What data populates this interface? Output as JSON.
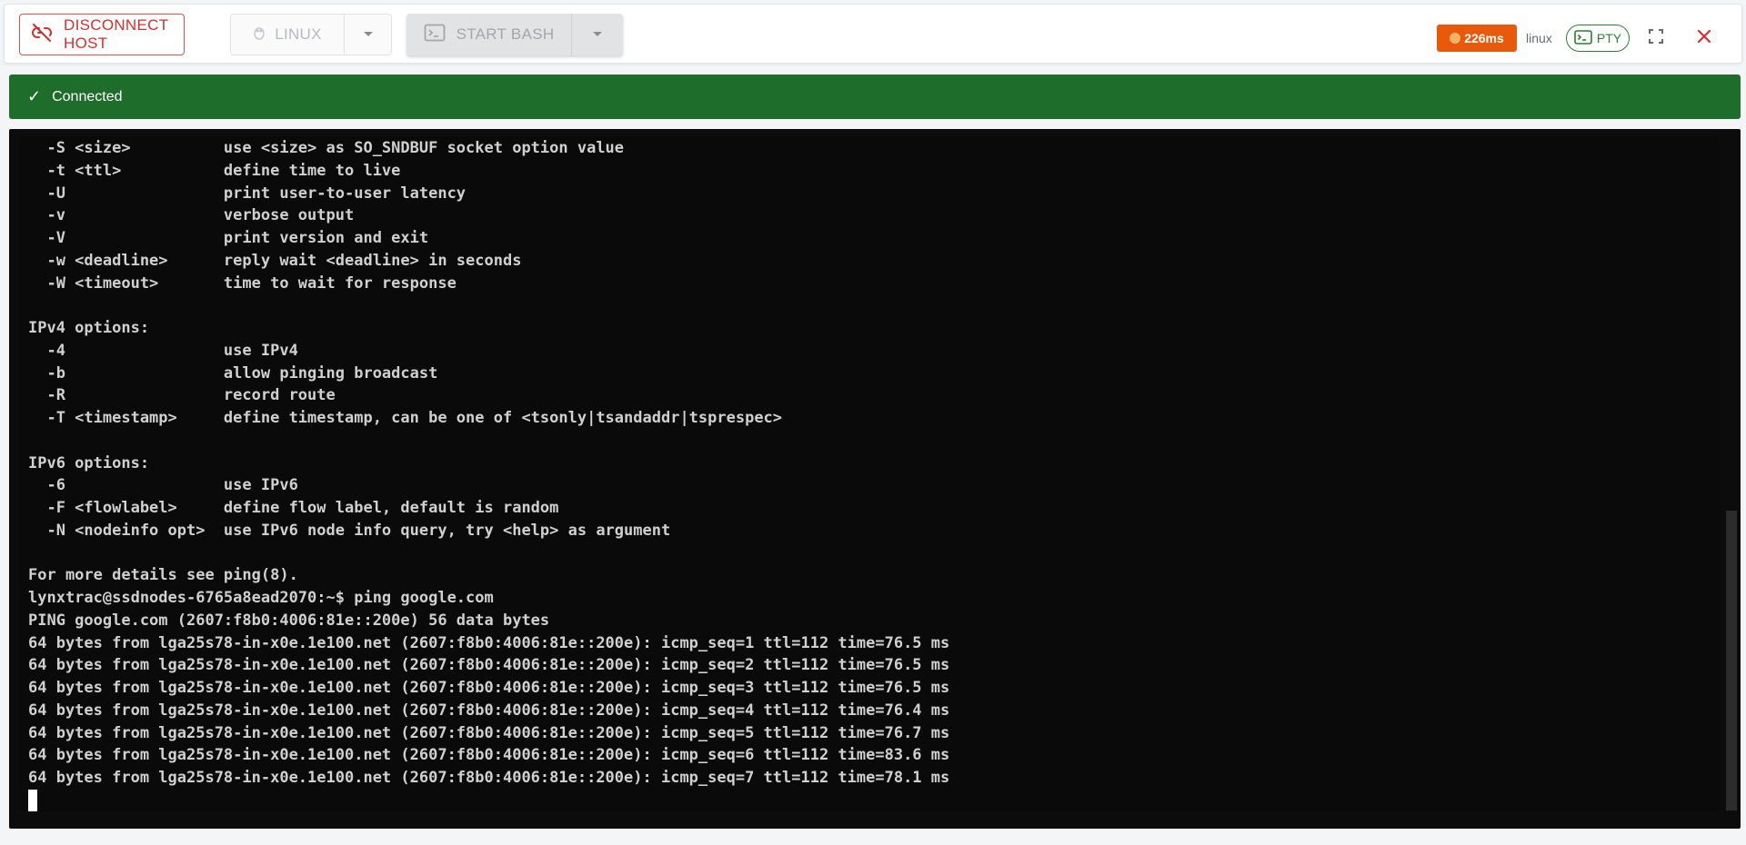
{
  "toolbar": {
    "disconnect_label": "DISCONNECT HOST",
    "os_select_label": "LINUX",
    "shell_label": "START BASH",
    "latency": "226ms",
    "os_name": "linux",
    "pty_label": "PTY"
  },
  "status": {
    "text": "Connected",
    "check": "✓"
  },
  "terminal": {
    "lines": [
      "  -S <size>          use <size> as SO_SNDBUF socket option value",
      "  -t <ttl>           define time to live",
      "  -U                 print user-to-user latency",
      "  -v                 verbose output",
      "  -V                 print version and exit",
      "  -w <deadline>      reply wait <deadline> in seconds",
      "  -W <timeout>       time to wait for response",
      "",
      "IPv4 options:",
      "  -4                 use IPv4",
      "  -b                 allow pinging broadcast",
      "  -R                 record route",
      "  -T <timestamp>     define timestamp, can be one of <tsonly|tsandaddr|tsprespec>",
      "",
      "IPv6 options:",
      "  -6                 use IPv6",
      "  -F <flowlabel>     define flow label, default is random",
      "  -N <nodeinfo opt>  use IPv6 node info query, try <help> as argument",
      "",
      "For more details see ping(8).",
      "lynxtrac@ssdnodes-6765a8ead2070:~$ ping google.com",
      "PING google.com (2607:f8b0:4006:81e::200e) 56 data bytes",
      "64 bytes from lga25s78-in-x0e.1e100.net (2607:f8b0:4006:81e::200e): icmp_seq=1 ttl=112 time=76.5 ms",
      "64 bytes from lga25s78-in-x0e.1e100.net (2607:f8b0:4006:81e::200e): icmp_seq=2 ttl=112 time=76.5 ms",
      "64 bytes from lga25s78-in-x0e.1e100.net (2607:f8b0:4006:81e::200e): icmp_seq=3 ttl=112 time=76.5 ms",
      "64 bytes from lga25s78-in-x0e.1e100.net (2607:f8b0:4006:81e::200e): icmp_seq=4 ttl=112 time=76.4 ms",
      "64 bytes from lga25s78-in-x0e.1e100.net (2607:f8b0:4006:81e::200e): icmp_seq=5 ttl=112 time=76.7 ms",
      "64 bytes from lga25s78-in-x0e.1e100.net (2607:f8b0:4006:81e::200e): icmp_seq=6 ttl=112 time=83.6 ms",
      "64 bytes from lga25s78-in-x0e.1e100.net (2607:f8b0:4006:81e::200e): icmp_seq=7 ttl=112 time=78.1 ms"
    ]
  },
  "colors": {
    "danger": "#d32f2f",
    "latency_badge": "#e8590c",
    "success": "#1f6d2a",
    "pty_green": "#2e7d32",
    "terminal_bg": "#0a0a0a",
    "terminal_text": "#d0d0d0"
  },
  "icons": {
    "disconnect": "link-off-icon",
    "os": "linux-tux-icon",
    "shell": "terminal-icon",
    "dropdown": "chevron-down-icon",
    "pty": "terminal-icon",
    "fullscreen": "fullscreen-icon",
    "close": "close-icon"
  }
}
